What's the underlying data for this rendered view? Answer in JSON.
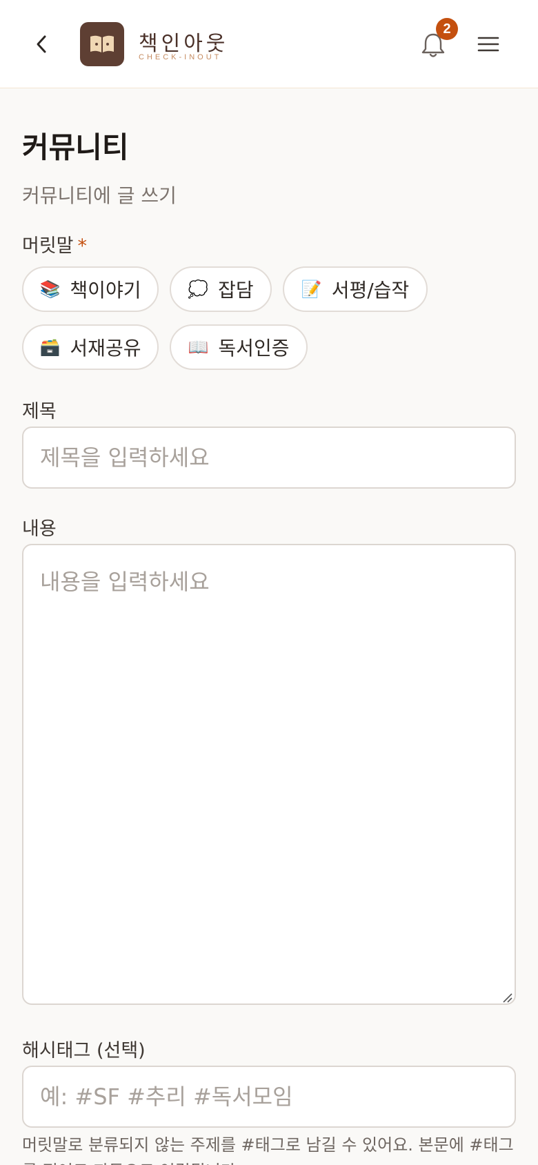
{
  "header": {
    "brand_name": "책인아웃",
    "brand_sub": "CHECK-INOUT",
    "notification_count": "2"
  },
  "page": {
    "title": "커뮤니티",
    "subtitle": "커뮤니티에 글 쓰기"
  },
  "form": {
    "category_label": "머릿말",
    "required_mark": "*",
    "categories": [
      {
        "emoji": "📚",
        "label": "책이야기"
      },
      {
        "emoji": "💭",
        "label": "잡담"
      },
      {
        "emoji": "📝",
        "label": "서평/습작"
      },
      {
        "emoji": "🗃️",
        "label": "서재공유"
      },
      {
        "emoji": "📖",
        "label": "독서인증"
      }
    ],
    "title_label": "제목",
    "title_placeholder": "제목을 입력하세요",
    "content_label": "내용",
    "content_placeholder": "내용을 입력하세요",
    "hashtag_label": "해시태그 (선택)",
    "hashtag_placeholder": "예: #SF #추리 #독서모임",
    "hashtag_help": "머릿말로 분류되지 않는 주제를 #태그로 남길 수 있어요. 본문에 #태그를 적어도 자동으로 연결됩니다."
  },
  "icons": {
    "back": "chevron-left-icon",
    "logo": "open-book-icon",
    "notifications": "bell-icon",
    "menu": "hamburger-menu-icon"
  },
  "colors": {
    "accent": "#c4500f",
    "logo_bg": "#5e3f33",
    "brand_sub": "#c58b60"
  }
}
